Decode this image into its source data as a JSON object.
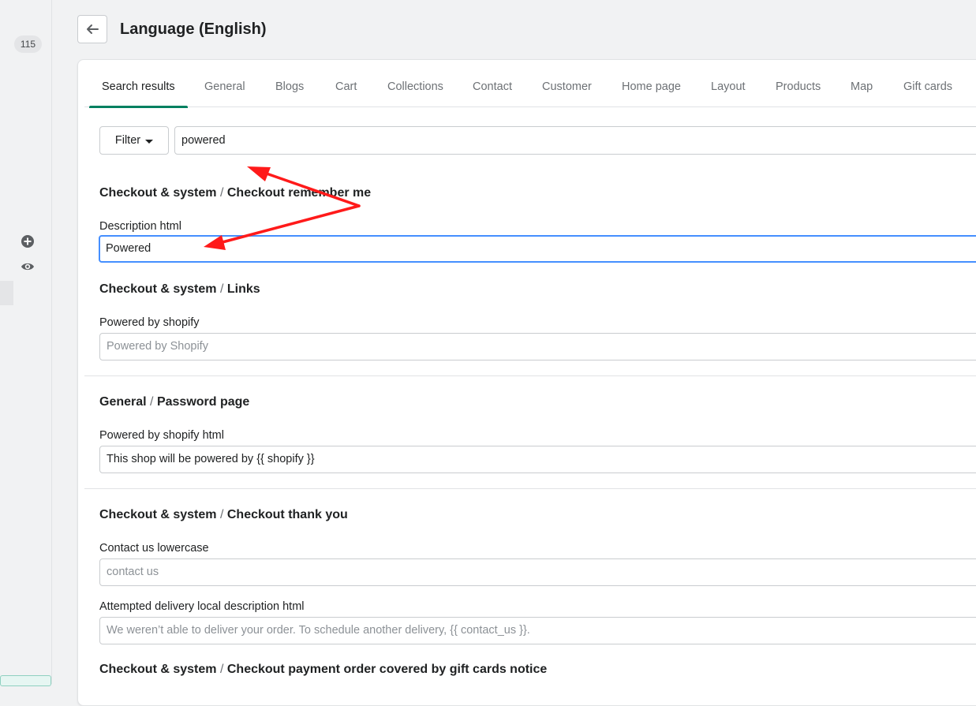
{
  "sidebar": {
    "count": "115"
  },
  "header": {
    "title": "Language (English)"
  },
  "tabs": [
    {
      "label": "Search results"
    },
    {
      "label": "General"
    },
    {
      "label": "Blogs"
    },
    {
      "label": "Cart"
    },
    {
      "label": "Collections"
    },
    {
      "label": "Contact"
    },
    {
      "label": "Customer"
    },
    {
      "label": "Home page"
    },
    {
      "label": "Layout"
    },
    {
      "label": "Products"
    },
    {
      "label": "Map"
    },
    {
      "label": "Gift cards"
    }
  ],
  "filter": {
    "label": "Filter",
    "search_value": "powered"
  },
  "sections": [
    {
      "group": "Checkout & system",
      "sep": "/",
      "name": "Checkout remember me",
      "fields": [
        {
          "label": "Description html",
          "value": "Powered"
        }
      ]
    },
    {
      "group": "Checkout & system",
      "sep": "/",
      "name": "Links",
      "fields": [
        {
          "label": "Powered by shopify",
          "placeholder": "Powered by Shopify"
        }
      ]
    },
    {
      "group": "General",
      "sep": "/",
      "name": "Password page",
      "fields": [
        {
          "label": "Powered by shopify html",
          "value": "This shop will be powered by {{ shopify }}"
        }
      ]
    },
    {
      "group": "Checkout & system",
      "sep": "/",
      "name": "Checkout thank you",
      "fields": [
        {
          "label": "Contact us lowercase",
          "placeholder": "contact us"
        },
        {
          "label": "Attempted delivery local description html",
          "placeholder": "We weren’t able to deliver your order. To schedule another delivery, {{ contact_us }}."
        }
      ]
    },
    {
      "group": "Checkout & system",
      "sep": "/",
      "name": "Checkout payment order covered by gift cards notice",
      "fields": []
    }
  ],
  "colors": {
    "accent": "#008060",
    "focus": "#458fff",
    "annotation": "#ff0000"
  },
  "icons": [
    "arrow-left-icon",
    "plus-circle-icon",
    "eye-icon",
    "caret-down-icon"
  ]
}
